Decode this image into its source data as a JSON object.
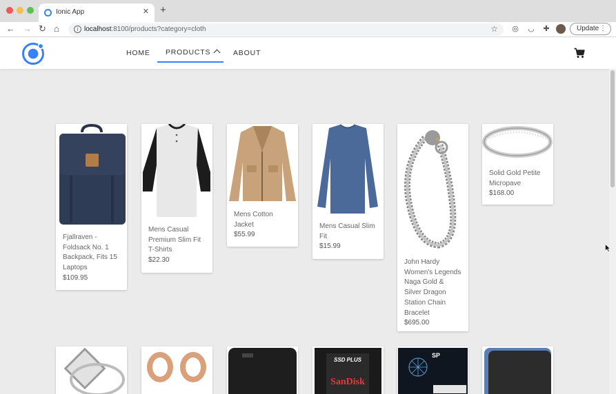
{
  "browser": {
    "tab_title": "Ionic App",
    "tab_close": "✕",
    "new_tab": "+",
    "url_host": "localhost",
    "url_rest": ":8100/products?category=cloth",
    "update_label": "Update",
    "update_menu": "⋮"
  },
  "nav": {
    "home": "HOME",
    "products": "PRODUCTS",
    "about": "ABOUT"
  },
  "colors": {
    "accent": "#3880ff"
  },
  "products": [
    {
      "title": "Fjallraven - Foldsack No. 1 Backpack, Fits 15 Laptops",
      "price": "$109.95"
    },
    {
      "title": "Mens Casual Premium Slim Fit T-Shirts",
      "price": "$22.30"
    },
    {
      "title": "Mens Cotton Jacket",
      "price": "$55.99"
    },
    {
      "title": "Mens Casual Slim Fit",
      "price": "$15.99"
    },
    {
      "title": "John Hardy Women's Legends Naga Gold & Silver Dragon Station Chain Bracelet",
      "price": "$695.00"
    },
    {
      "title": "Solid Gold Petite Micropave",
      "price": "$168.00"
    }
  ],
  "row2_labels": {
    "sandisk_top": "SSD PLUS",
    "sandisk_brand": "SanDisk",
    "sp_brand": "SP"
  }
}
